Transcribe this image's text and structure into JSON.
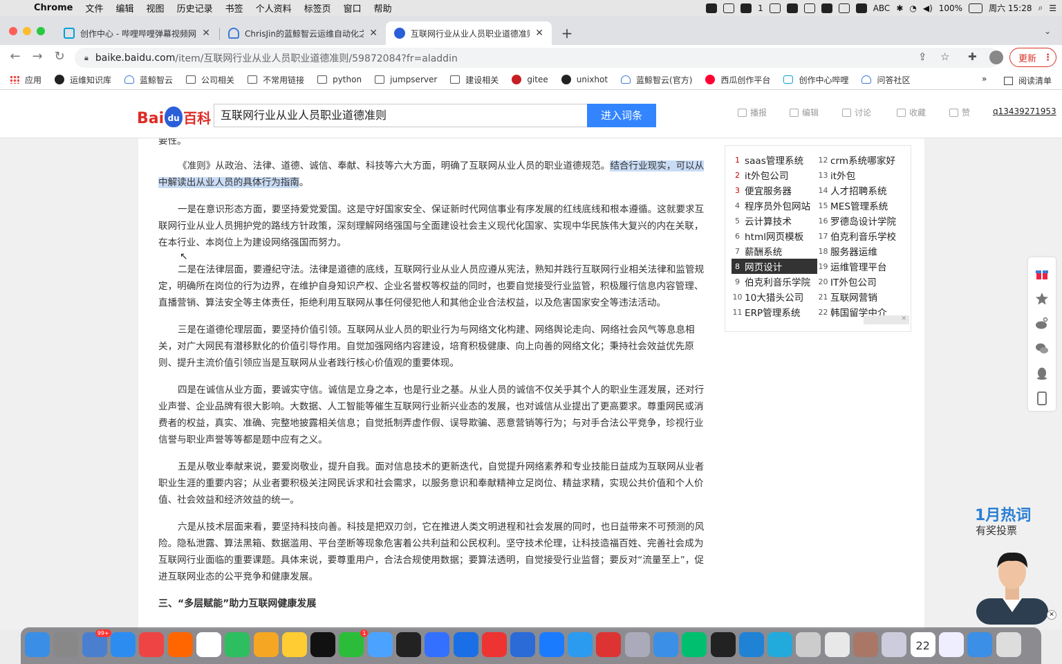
{
  "menubar": {
    "app": "Chrome",
    "items": [
      "文件",
      "编辑",
      "视图",
      "历史记录",
      "书签",
      "个人资料",
      "标签页",
      "窗口",
      "帮助"
    ],
    "tray_count": "1",
    "input_method": "ABC",
    "battery": "100%",
    "clock": "周六 15:28"
  },
  "tabs": [
    {
      "title": "创作中心 - 哔哩哔哩弹幕视频网",
      "icon": "bilibili-tv-icon",
      "color": "#00a1d6"
    },
    {
      "title": "ChrisJin的蓝鲸智云运维自动化之",
      "icon": "bluking-cloud-icon",
      "color": "#3a7bd5"
    },
    {
      "title": "互联网行业从业人员职业道德准则",
      "icon": "baidu-paw-icon",
      "color": "#2b5fd9"
    }
  ],
  "address": {
    "domain": "baike.baidu.com",
    "path": "/item/互联网行业从业人员职业道德准则/59872084?fr=aladdin",
    "update_label": "更新"
  },
  "bookmarks": [
    {
      "label": "应用",
      "icon": "apps"
    },
    {
      "label": "运维知识库",
      "icon": "circle"
    },
    {
      "label": "蓝鲸智云",
      "icon": "cloud"
    },
    {
      "label": "公司相关",
      "icon": "folder"
    },
    {
      "label": "不常用链接",
      "icon": "folder"
    },
    {
      "label": "python",
      "icon": "folder"
    },
    {
      "label": "jumpserver",
      "icon": "folder"
    },
    {
      "label": "建设相关",
      "icon": "folder"
    },
    {
      "label": "gitee",
      "icon": "gitee"
    },
    {
      "label": "unixhot",
      "icon": "circle"
    },
    {
      "label": "蓝鲸智云(官方)",
      "icon": "cloud"
    },
    {
      "label": "西瓜创作平台",
      "icon": "xigua"
    },
    {
      "label": "创作中心哔哩",
      "icon": "tv"
    },
    {
      "label": "问答社区",
      "icon": "cloud"
    }
  ],
  "bookmarks_more": "»",
  "reading_list": "阅读清单",
  "baike": {
    "logo_bai": "Bai",
    "logo_du": "du",
    "logo_baike": "百科",
    "search_value": "互联网行业从业人员职业道德准则",
    "search_button": "进入词条",
    "actions": [
      "播报",
      "编辑",
      "讨论",
      "收藏",
      "赞"
    ],
    "user": "q13439271953"
  },
  "article": {
    "cut_line": "要性。",
    "p0_plain": "《准则》从政治、法律、道德、诚信、奉献、科技等六大方面，明确了互联网从业人员的职业道德规范。",
    "p0_highlight": "结合行业现实，可以从中解读出从业人员的具体行为指南",
    "p0_end": "。",
    "paragraphs": [
      "一是在意识形态方面，要坚持爱党爱国。这是守好国家安全、保证新时代网信事业有序发展的红线底线和根本遵循。这就要求互联网行业从业人员拥护党的路线方针政策，深刻理解网络强国与全面建设社会主义现代化国家、实现中华民族伟大复兴的内在关联，在本行业、本岗位上为建设网络强国而努力。",
      "二是在法律层面，要遵纪守法。法律是道德的底线，互联网行业从业人员应遵从宪法，熟知并践行互联网行业相关法律和监管规定，明确所在岗位的行为边界，在维护自身知识产权、企业名誉权等权益的同时，也要自觉接受行业监管，积极履行信息内容管理、直播营销、算法安全等主体责任，拒绝利用互联网从事任何侵犯他人和其他企业合法权益，以及危害国家安全等违法活动。",
      "三是在道德伦理层面，要坚持价值引领。互联网从业人员的职业行为与网络文化构建、网络舆论走向、网络社会风气等息息相关，对广大网民有潜移默化的价值引导作用。自觉加强网络内容建设，培育积极健康、向上向善的网络文化；秉持社会效益优先原则、提升主流价值引领应当是互联网从业者践行核心价值观的重要体现。",
      "四是在诚信从业方面，要诚实守信。诚信是立身之本，也是行业之基。从业人员的诚信不仅关乎其个人的职业生涯发展，还对行业声誉、企业品牌有很大影响。大数据、人工智能等催生互联网行业新兴业态的发展，也对诚信从业提出了更高要求。尊重网民或消费者的权益，真实、准确、完整地披露相关信息；自觉抵制弄虚作假、误导欺骗、恶意营销等行为；与对手合法公平竞争，珍视行业信誉与职业声誉等等都是题中应有之义。",
      "五是从敬业奉献来说，要爱岗敬业，提升自我。面对信息技术的更新迭代，自觉提升网络素养和专业技能日益成为互联网从业者职业生涯的重要内容；从业者要积极关注网民诉求和社会需求，以服务意识和奉献精神立足岗位、精益求精，实现公共价值和个人价值、社会效益和经济效益的统一。",
      "六是从技术层面来看，要坚持科技向善。科技是把双刃剑，它在推进人类文明进程和社会发展的同时，也日益带来不可预测的风险。隐私泄露、算法黑箱、数据滥用、平台垄断等现象危害着公共利益和公民权利。坚守技术伦理，让科技造福百姓、完善社会成为互联网行业面临的重要课题。具体来说，要尊重用户，合法合规使用数据；要算法透明，自觉接受行业监督；要反对“流量至上”，促进互联网业态的公平竞争和健康发展。"
    ],
    "next_heading": "三、“多层赋能”助力互联网健康发展"
  },
  "hotlist": {
    "left": [
      {
        "n": "1",
        "t": "saas管理系统"
      },
      {
        "n": "2",
        "t": "it外包公司"
      },
      {
        "n": "3",
        "t": "便宜服务器"
      },
      {
        "n": "4",
        "t": "程序员外包网站"
      },
      {
        "n": "5",
        "t": "云计算技术"
      },
      {
        "n": "6",
        "t": "html网页模板"
      },
      {
        "n": "7",
        "t": "薪酬系统"
      },
      {
        "n": "8",
        "t": "网页设计"
      },
      {
        "n": "9",
        "t": "伯克利音乐学院"
      },
      {
        "n": "10",
        "t": "10大猎头公司"
      },
      {
        "n": "11",
        "t": "ERP管理系统"
      }
    ],
    "right": [
      {
        "n": "12",
        "t": "crm系统哪家好"
      },
      {
        "n": "13",
        "t": "it外包"
      },
      {
        "n": "14",
        "t": "人才招聘系统"
      },
      {
        "n": "15",
        "t": "MES管理系统"
      },
      {
        "n": "16",
        "t": "罗德岛设计学院"
      },
      {
        "n": "17",
        "t": "伯克利音乐学校"
      },
      {
        "n": "18",
        "t": "服务器运维"
      },
      {
        "n": "19",
        "t": "运维管理平台"
      },
      {
        "n": "20",
        "t": "IT外包公司"
      },
      {
        "n": "21",
        "t": "互联网营销"
      },
      {
        "n": "22",
        "t": "韩国留学中介"
      }
    ],
    "selected": "8"
  },
  "side_tools": [
    "gift-icon",
    "star-icon",
    "weibo-icon",
    "wechat-icon",
    "qq-icon",
    "mobile-icon"
  ],
  "promo": {
    "title": "1月热词",
    "subtitle": "有奖投票"
  },
  "dock": {
    "badge_mail": "99+",
    "badge_wechat": "1",
    "calendar_day": "22",
    "icons": [
      "finder",
      "launchpad",
      "mail-client",
      "safari",
      "chrome",
      "firefox",
      "typora",
      "evernote",
      "photos",
      "notes",
      "qq",
      "wechat",
      "messages",
      "terminal-dark",
      "feishu",
      "teamviewer",
      "wps",
      "word",
      "keynote",
      "dingtalk",
      "textedit",
      "network-utility",
      "baidu-netdisk",
      "iqiyi",
      "terminal",
      "vscode",
      "pycharm",
      "preview",
      "pages",
      "contacts",
      "tooltrain",
      "calendar",
      "screenshot",
      "icloud",
      "trash"
    ]
  }
}
